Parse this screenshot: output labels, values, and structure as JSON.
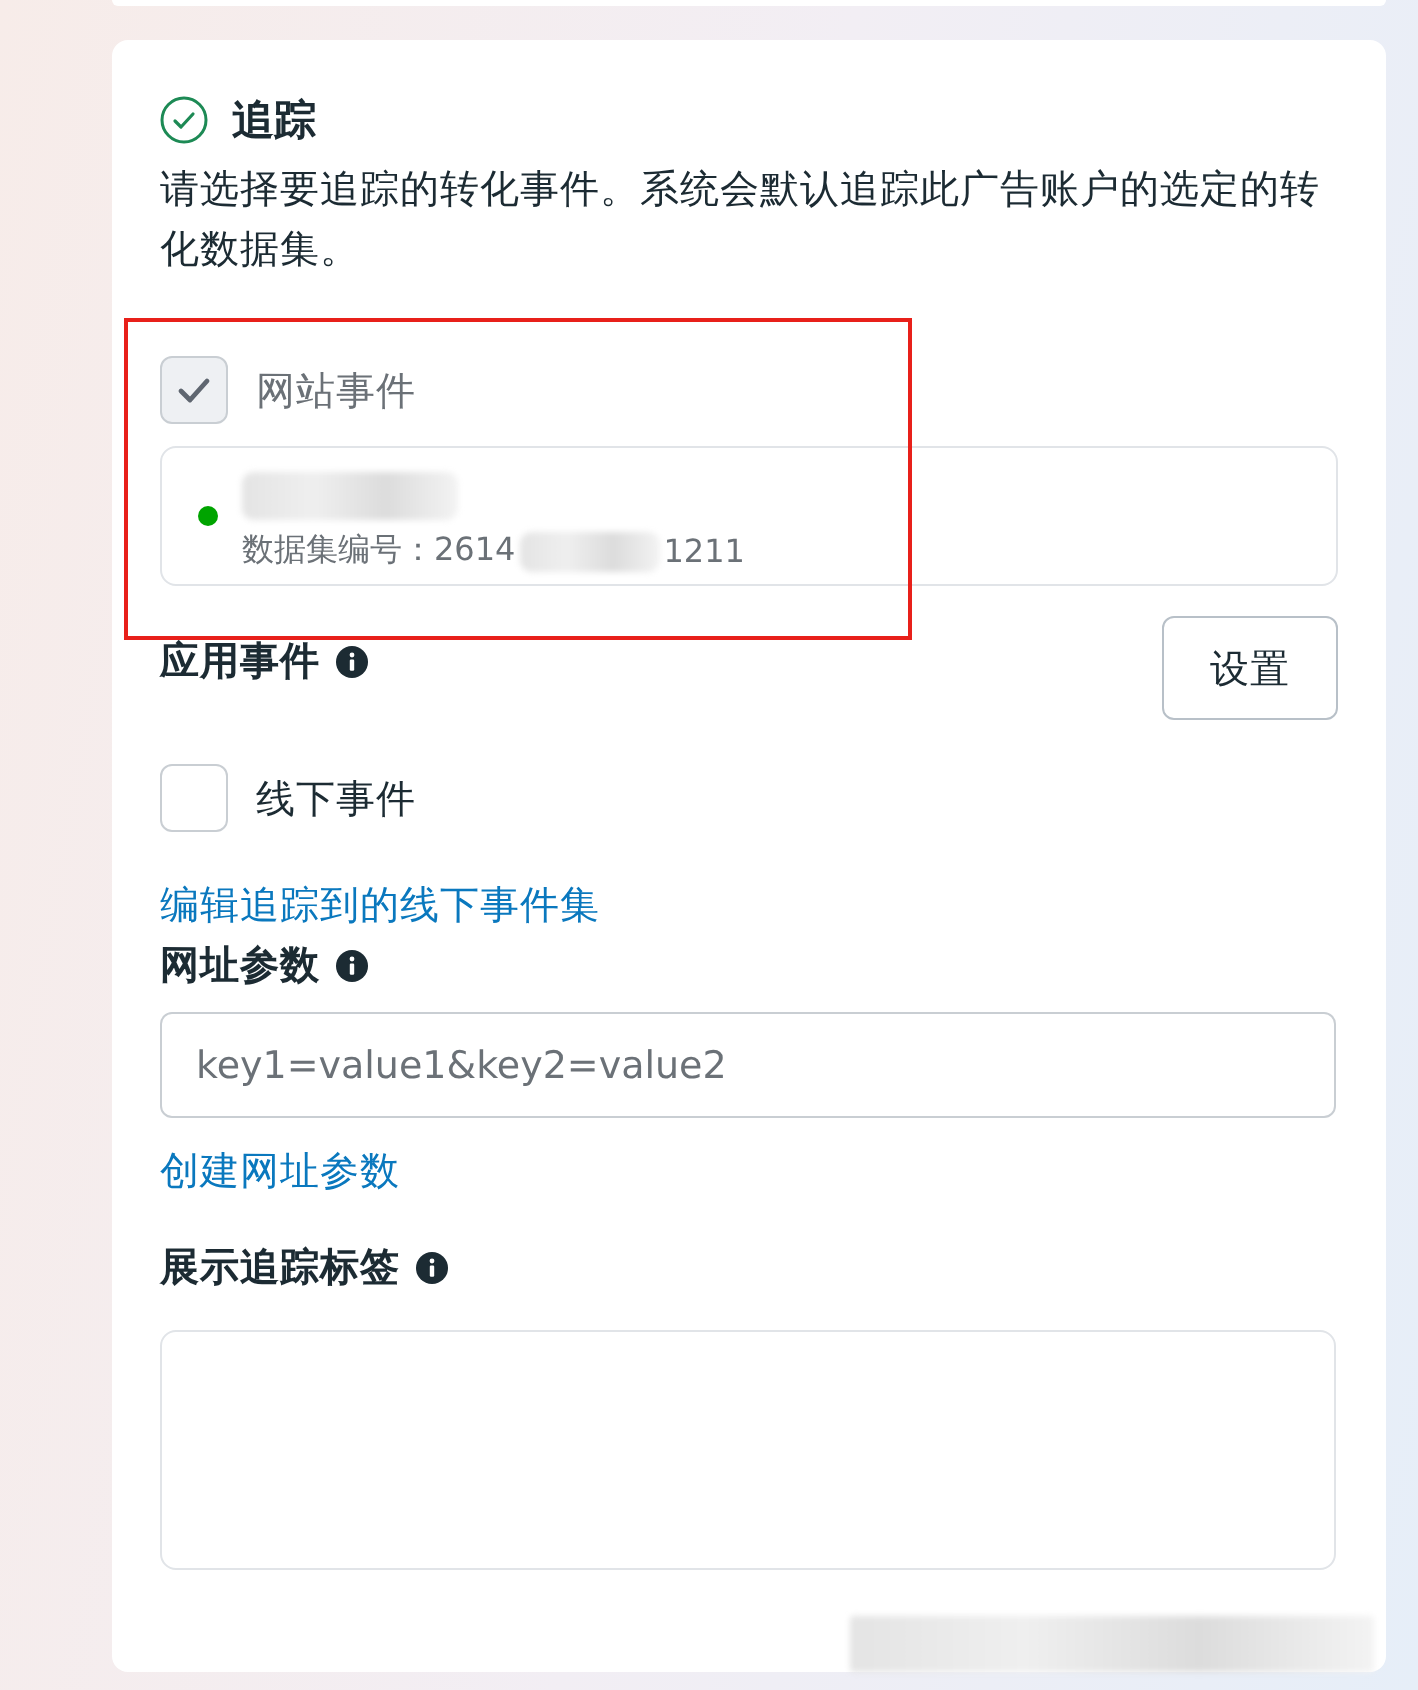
{
  "section": {
    "title": "追踪",
    "done": true,
    "description": "请选择要追踪的转化事件。系统会默认追踪此广告账户的选定的转化数据集。"
  },
  "website_events": {
    "label": "网站事件",
    "checked": true,
    "disabled": true,
    "dataset": {
      "color": "#00a400",
      "id_label": "数据集编号：2614",
      "id_tail": "1211"
    }
  },
  "app_events": {
    "label": "应用事件",
    "button": "设置"
  },
  "offline_events": {
    "label": "线下事件",
    "checked": false,
    "disabled": false
  },
  "offline_link": "编辑追踪到的线下事件集",
  "url_params": {
    "label": "网址参数",
    "placeholder": "key1=value1&key2=value2",
    "link": "创建网址参数"
  },
  "display_tags": {
    "label": "展示追踪标签"
  }
}
